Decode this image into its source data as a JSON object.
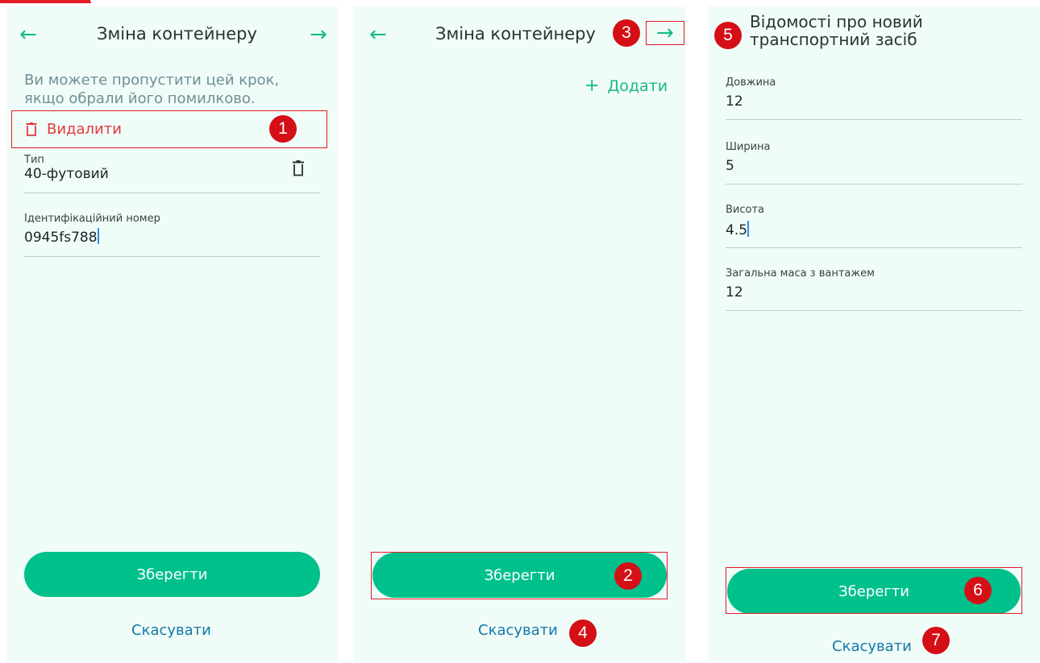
{
  "panel1": {
    "title": "Зміна контейнеру",
    "back_icon": "arrow-left-icon",
    "next_icon": "arrow-right-icon",
    "hint_line1": "Ви можете пропустити цей крок,",
    "hint_line2": "якщо обрали його помилково.",
    "delete_label": "Видалити",
    "type_label": "Тип",
    "type_value": "40-футовий",
    "id_label": "Ідентифікаційний номер",
    "id_value": "0945fs788",
    "save_label": "Зберегти",
    "cancel_label": "Скасувати",
    "badge": "1"
  },
  "panel2": {
    "title": "Зміна контейнеру",
    "add_plus": "+",
    "add_label": "Додати",
    "save_label": "Зберегти",
    "cancel_label": "Скасувати",
    "badge_next": "3",
    "badge_save": "2",
    "badge_cancel": "4"
  },
  "panel3": {
    "title_line1": "Відомості про новий",
    "title_line2": "транспортний засіб",
    "fields": [
      {
        "label": "Довжина",
        "value": "12"
      },
      {
        "label": "Ширина",
        "value": "5"
      },
      {
        "label": "Висота",
        "value": "4.5"
      },
      {
        "label": "Загальна маса з вантажем",
        "value": "12"
      }
    ],
    "save_label": "Зберегти",
    "cancel_label": "Скасувати",
    "badge_title": "5",
    "badge_save": "6",
    "badge_cancel": "7"
  },
  "colors": {
    "accent": "#00c08b",
    "danger": "#e5383b",
    "link": "#1378a8",
    "panel_bg": "#f0fcf8",
    "annotation_red": "#e21b23"
  }
}
